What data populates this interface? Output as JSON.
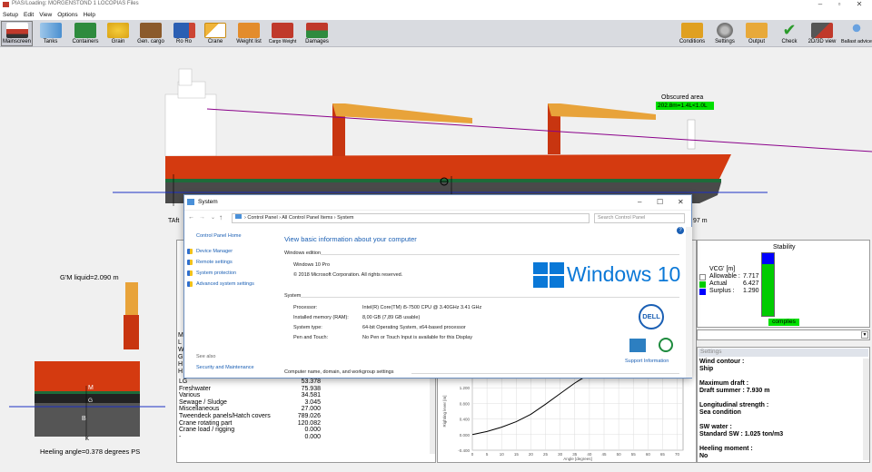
{
  "app": {
    "title": "PIAS/Loading: MORGENSTOND 1    LOCOPIAS Files",
    "menu": [
      "Setup",
      "Edit",
      "View",
      "Options",
      "Help"
    ]
  },
  "toolbar": {
    "left": [
      "Mainscreen",
      "Tanks",
      "Containers",
      "Grain",
      "Gen. cargo",
      "Ro Ro",
      "Crane",
      "Weight list",
      "Cargo Weight",
      "Damages"
    ],
    "right": [
      "Conditions",
      "Settings",
      "Output",
      "Check",
      "2D/3D view",
      "Ballast advice"
    ]
  },
  "profile": {
    "obscured_title": "Obscured area",
    "obscured_value": "202.8m=1.4L<1.0L",
    "ta_label": "TAft",
    "right_value": "97 m"
  },
  "section": {
    "gm_label": "G'M liquid=2.090 m",
    "heel_label": "Heeling angle=0.378 degrees PS",
    "marks": [
      "M",
      "G",
      "B",
      "K"
    ]
  },
  "weights": {
    "rows": [
      {
        "name": "LG",
        "value": "53.378"
      },
      {
        "name": "Freshwater",
        "value": "75.938"
      },
      {
        "name": "Various",
        "value": "34.581"
      },
      {
        "name": "Sewage / Sludge",
        "value": "3.045"
      },
      {
        "name": "Miscellaneous",
        "value": "27.000"
      },
      {
        "name": "Tweendeck panels/Hatch covers",
        "value": "789.026"
      },
      {
        "name": "Crane rotating part",
        "value": "120.082"
      },
      {
        "name": "Crane load / rigging",
        "value": "0.000"
      },
      {
        "name": "-",
        "value": "0.000"
      }
    ],
    "left_letters": [
      "M",
      "L",
      "W",
      "G",
      "H",
      "H"
    ]
  },
  "chart": {
    "ylabel": "Righting lever [m]",
    "xlabel": "Angle [degrees]",
    "yticks": [
      "1.600",
      "1.200",
      "0.800",
      "0.400",
      "0.000",
      "-0.400"
    ],
    "xticks": [
      "0",
      "5",
      "10",
      "15",
      "20",
      "25",
      "30",
      "35",
      "40",
      "45",
      "50",
      "55",
      "60",
      "65",
      "70"
    ]
  },
  "chart_data": {
    "type": "line",
    "xlabel": "Angle [degrees]",
    "ylabel": "Righting lever [m]",
    "xlim": [
      0,
      72
    ],
    "ylim": [
      -0.4,
      1.6
    ],
    "series": [
      {
        "x": [
          0,
          5,
          10,
          15,
          20,
          25,
          30,
          35,
          40,
          45
        ],
        "values": [
          0.0,
          0.08,
          0.19,
          0.33,
          0.52,
          0.78,
          1.05,
          1.32,
          1.55,
          1.7
        ]
      }
    ]
  },
  "stability": {
    "title": "Stability",
    "vcg_label": "VCG' [m]",
    "allowable_label": "Allowable :",
    "allowable_value": "7.717",
    "actual_label": "Actual",
    "actual_value": "6.427",
    "surplus_label": "Surplus :",
    "surplus_value": "1.290",
    "complies": "complies",
    "actual_fraction": 0.83,
    "colors": {
      "allowable": "#ffffff",
      "actual": "#00cc00",
      "surplus": "#0000ff"
    }
  },
  "settings": {
    "header": "Settings",
    "items": [
      {
        "title": "Wind contour :",
        "value": "Ship"
      },
      {
        "title": "Maximum draft :",
        "value": "Draft summer : 7.930 m"
      },
      {
        "title": "Longitudinal strength :",
        "value": "Sea condition"
      },
      {
        "title": "SW water :",
        "value": "Standard SW : 1.025 ton/m3"
      },
      {
        "title": "Heeling moment :",
        "value": "No"
      }
    ]
  },
  "system_window": {
    "title": "System",
    "breadcrumb": [
      "Control Panel",
      "All Control Panel Items",
      "System"
    ],
    "search_placeholder": "Search Control Panel",
    "side_home": "Control Panel Home",
    "side_links": [
      "Device Manager",
      "Remote settings",
      "System protection",
      "Advanced system settings"
    ],
    "see_also": "See also",
    "see_also_link": "Security and Maintenance",
    "heading": "View basic information about your computer",
    "edition_header": "Windows edition",
    "edition": "Windows 10 Pro",
    "copyright": "© 2018 Microsoft Corporation. All rights reserved.",
    "logo_text": "Windows 10",
    "system_header": "System",
    "rows": [
      {
        "label": "Processor:",
        "value": "Intel(R) Core(TM) i5-7500 CPU @ 3.40GHz   3.41 GHz"
      },
      {
        "label": "Installed memory (RAM):",
        "value": "8,00 GB (7,89 GB usable)"
      },
      {
        "label": "System type:",
        "value": "64-bit Operating System, x64-based processor"
      },
      {
        "label": "Pen and Touch:",
        "value": "No Pen or Touch Input is available for this Display"
      }
    ],
    "support": "Support Information",
    "computer_header": "Computer name, domain, and workgroup settings",
    "dell": "DELL"
  }
}
